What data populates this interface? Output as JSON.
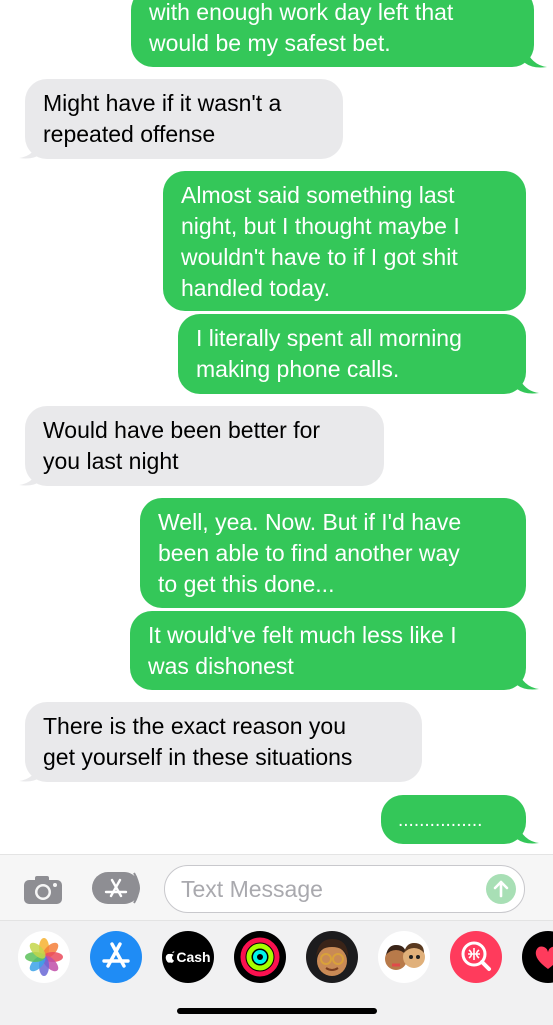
{
  "messages": [
    {
      "text": "with enough work day left that\nwould be my safest bet."
    },
    {
      "text": "Might have if it wasn't a\nrepeated offense"
    },
    {
      "text": "Almost said something last\nnight, but I thought maybe I\nwouldn't have to if I got shit\nhandled today."
    },
    {
      "text": "I literally spent all morning\nmaking phone calls."
    },
    {
      "text": "Would have been better for\nyou last night"
    },
    {
      "text": "Well, yea. Now. But if I'd have\nbeen able to find another way\nto get this done..."
    },
    {
      "text": "It would've felt much less like I\nwas dishonest"
    },
    {
      "text": "There is the exact reason you\nget yourself in these situations"
    },
    {
      "text": "................"
    }
  ],
  "compose": {
    "placeholder": "Text Message",
    "camera_icon": "camera-icon",
    "apps_icon": "app-store-icon",
    "send_icon": "send-arrow-icon"
  },
  "app_drawer": {
    "cash_label": "Cash",
    "apps": [
      "photos-icon",
      "app-store-icon",
      "apple-cash-icon",
      "activity-icon",
      "memoji-icon",
      "memoji-stickers-icon",
      "web-images-icon",
      "digital-touch-icon"
    ]
  },
  "colors": {
    "outgoing_bubble": "#34c759",
    "incoming_bubble": "#e9e9eb",
    "background": "#ffffff"
  }
}
